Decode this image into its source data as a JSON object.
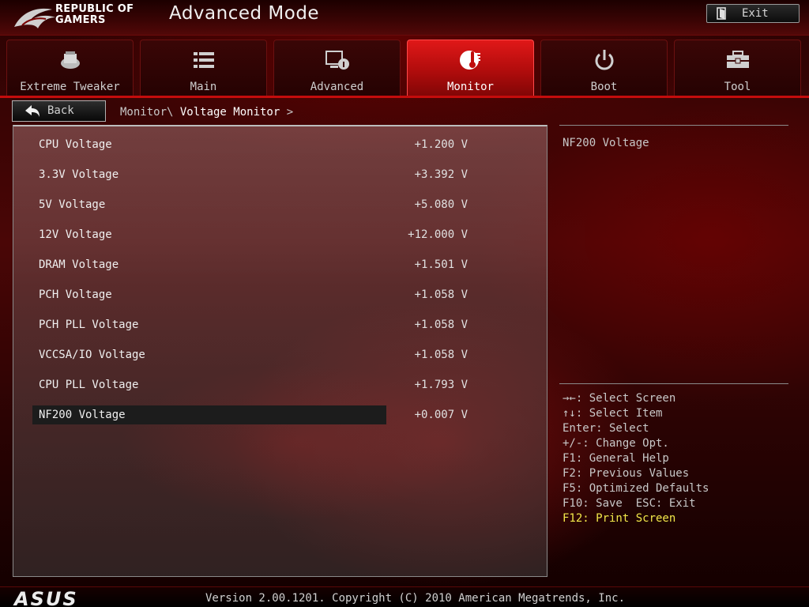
{
  "header": {
    "brand_line1": "REPUBLIC OF",
    "brand_line2": "GAMERS",
    "title": "Advanced Mode",
    "exit_label": "Exit"
  },
  "tabs": [
    {
      "label": "Extreme Tweaker",
      "icon": "tweaker-icon",
      "active": false
    },
    {
      "label": "Main",
      "icon": "list-icon",
      "active": false
    },
    {
      "label": "Advanced",
      "icon": "advanced-icon",
      "active": false
    },
    {
      "label": "Monitor",
      "icon": "thermometer-icon",
      "active": true
    },
    {
      "label": "Boot",
      "icon": "power-icon",
      "active": false
    },
    {
      "label": "Tool",
      "icon": "toolbox-icon",
      "active": false
    }
  ],
  "nav": {
    "back_label": "Back",
    "breadcrumb_parent": "Monitor\\ ",
    "breadcrumb_current": "Voltage Monitor",
    "breadcrumb_suffix": " >"
  },
  "voltages": [
    {
      "name": "CPU Voltage",
      "value": "+1.200 V"
    },
    {
      "name": "3.3V Voltage",
      "value": "+3.392 V"
    },
    {
      "name": "5V Voltage",
      "value": "+5.080 V"
    },
    {
      "name": "12V Voltage",
      "value": "+12.000 V"
    },
    {
      "name": "DRAM Voltage",
      "value": "+1.501 V"
    },
    {
      "name": "PCH Voltage",
      "value": "+1.058 V"
    },
    {
      "name": "PCH PLL Voltage",
      "value": "+1.058 V"
    },
    {
      "name": "VCCSA/IO Voltage",
      "value": "+1.058 V"
    },
    {
      "name": "CPU PLL Voltage",
      "value": "+1.793 V"
    },
    {
      "name": "NF200 Voltage",
      "value": "+0.007 V",
      "selected": true
    }
  ],
  "help": {
    "title": "NF200 Voltage",
    "keys": [
      "→←: Select Screen",
      "↑↓: Select Item",
      "Enter: Select",
      "+/-: Change Opt.",
      "F1: General Help",
      "F2: Previous Values",
      "F5: Optimized Defaults",
      "F10: Save  ESC: Exit",
      "F12: Print Screen"
    ]
  },
  "footer": {
    "logo": "ASUS",
    "version": "Version 2.00.1201. Copyright (C) 2010 American Megatrends, Inc."
  },
  "colors": {
    "accent_red": "#c40c0c",
    "active_tab": "#e01818",
    "highlight_key": "#f2e84a"
  }
}
